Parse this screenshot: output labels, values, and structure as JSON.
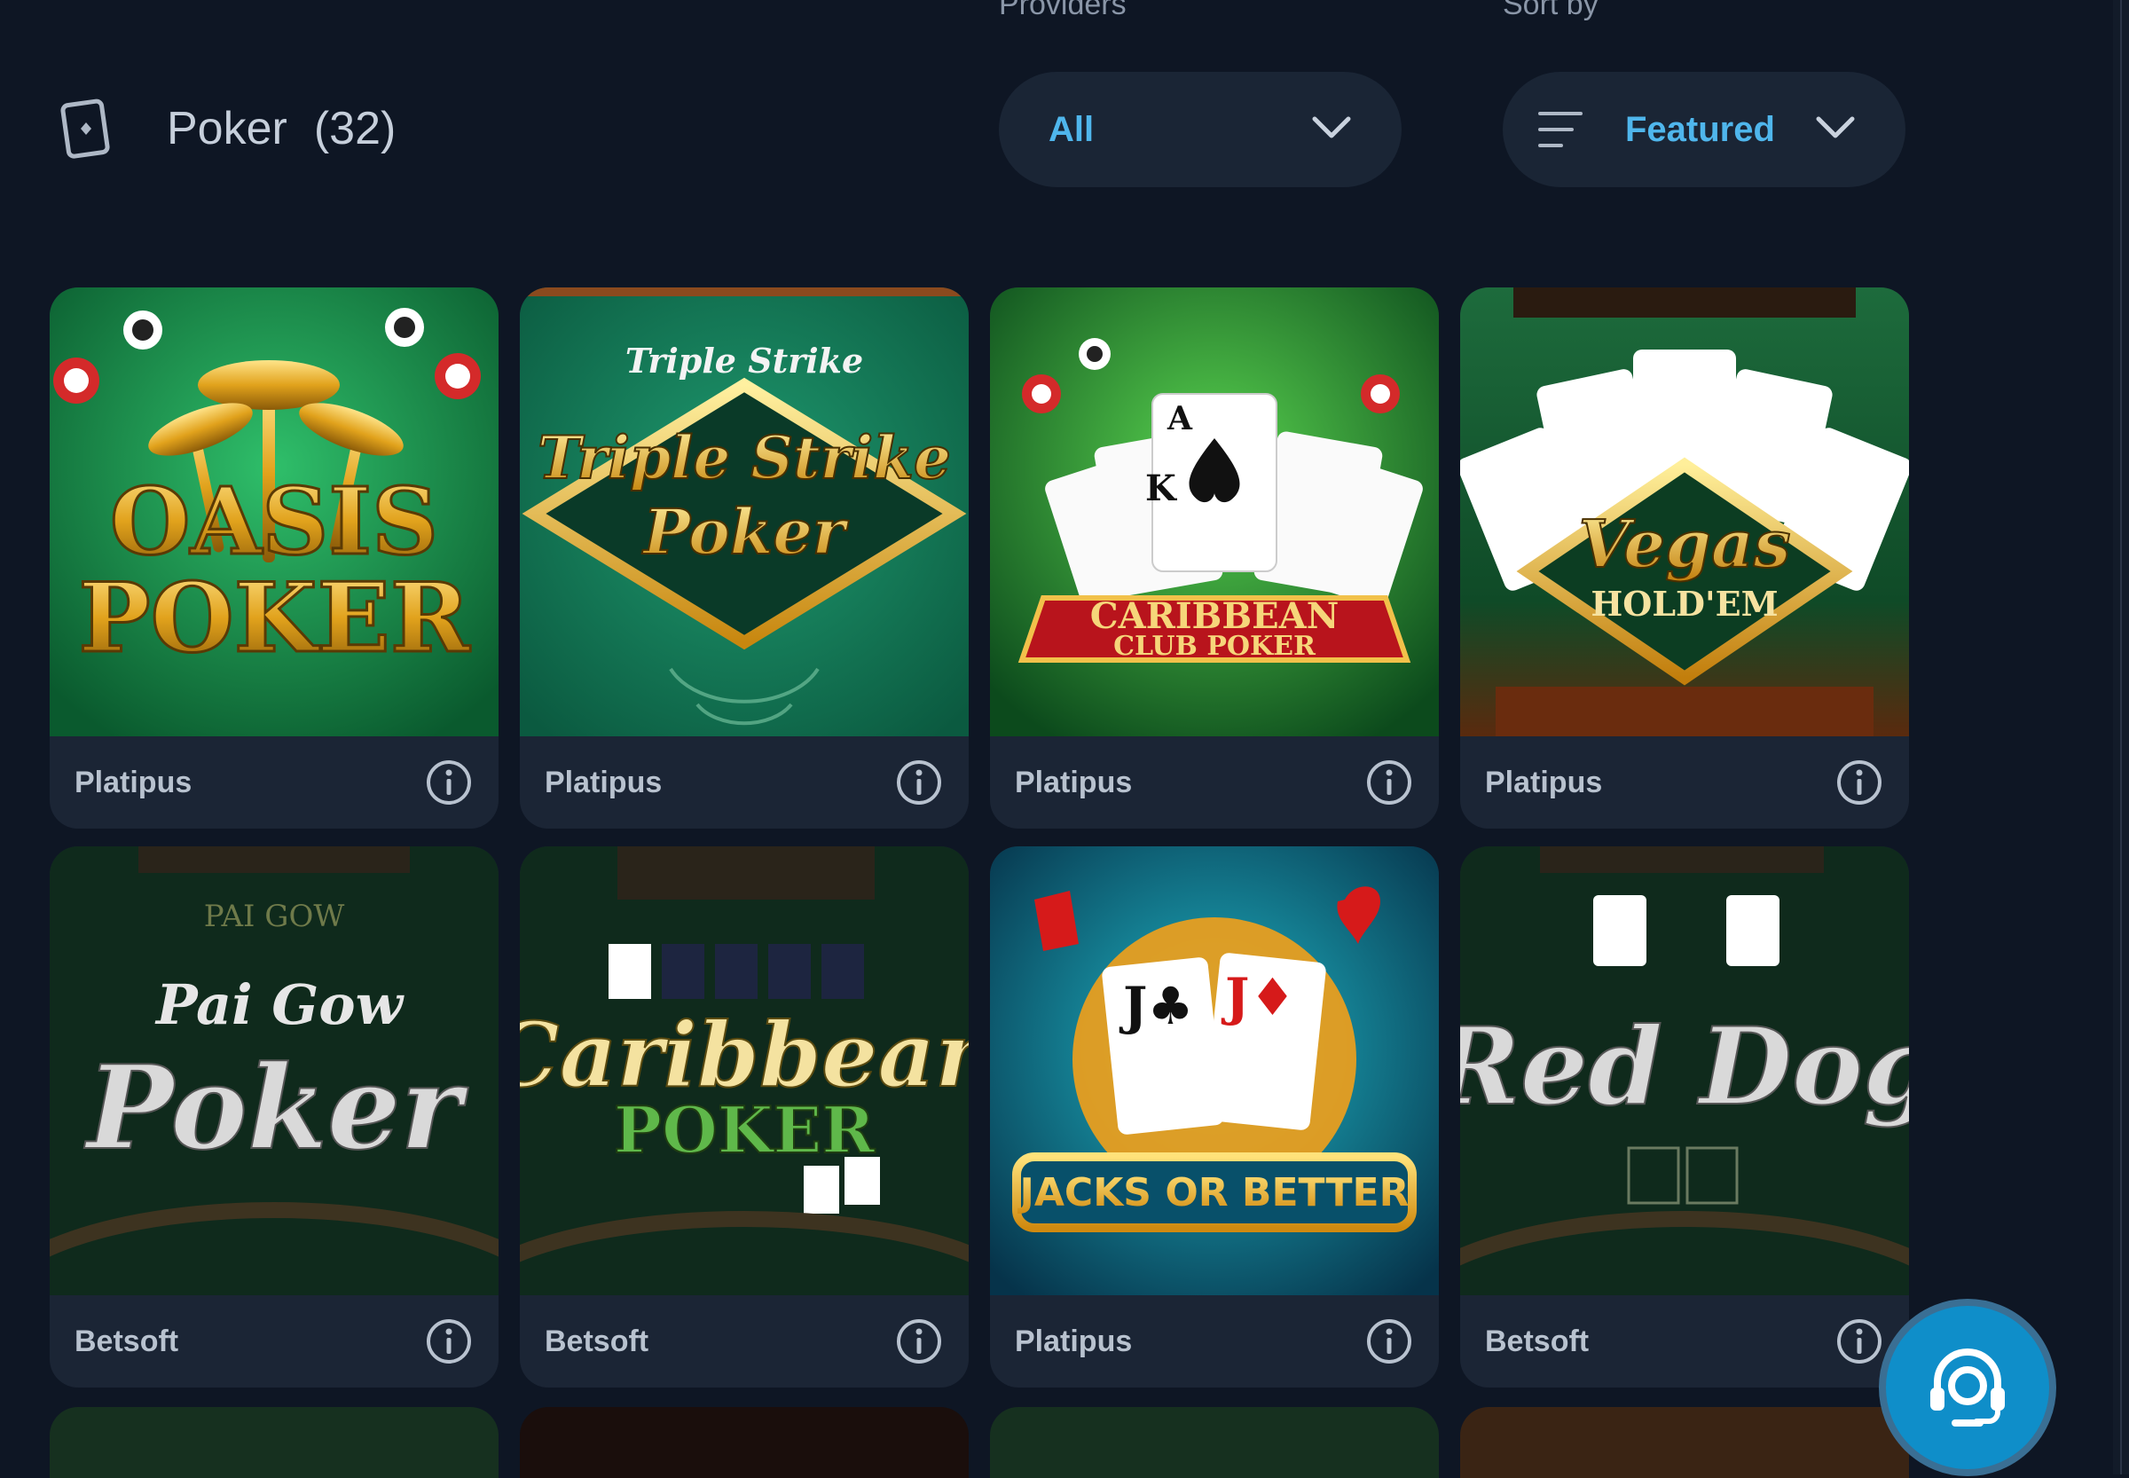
{
  "filters": {
    "providers_label": "Providers",
    "providers_value": "All",
    "sort_label": "Sort by",
    "sort_value": "Featured"
  },
  "category": {
    "icon": "card-icon",
    "title": "Poker",
    "count": "(32)"
  },
  "games": [
    {
      "title": "OASIS POKER",
      "provider": "Platipus"
    },
    {
      "title": "Triple Strike Poker",
      "provider": "Platipus"
    },
    {
      "title": "CARIBBEAN CLUB POKER",
      "provider": "Platipus"
    },
    {
      "title": "Vegas HOLD'EM",
      "provider": "Platipus"
    },
    {
      "title": "Pai Gow Poker",
      "provider": "Betsoft"
    },
    {
      "title": "Caribbean POKER",
      "provider": "Betsoft"
    },
    {
      "title": "JACKS OR BETTER",
      "provider": "Platipus"
    },
    {
      "title": "Red Dog",
      "provider": "Betsoft"
    }
  ],
  "colors": {
    "background": "#0e1624",
    "card": "#1b2535",
    "accent": "#4fb6ec",
    "support": "#0f8ec9"
  },
  "support": {
    "icon": "headset-icon"
  }
}
